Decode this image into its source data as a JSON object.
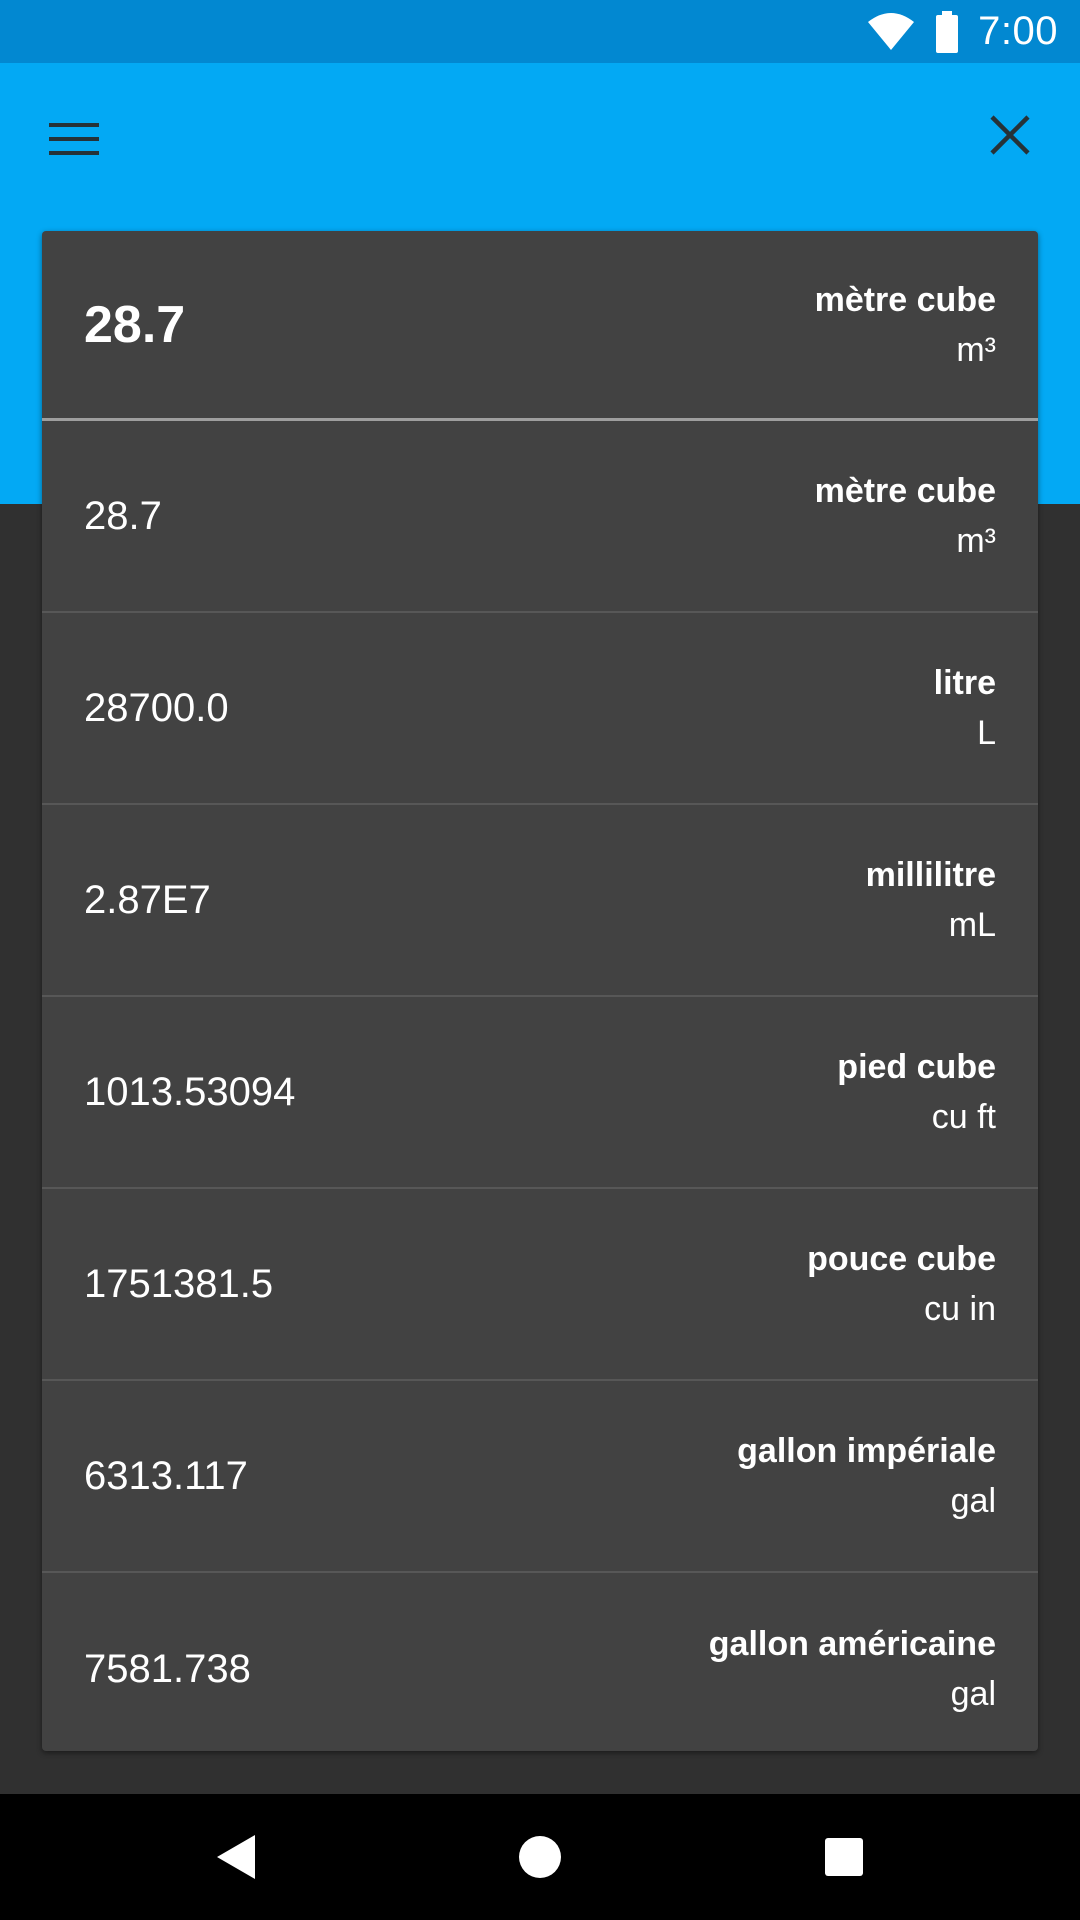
{
  "status_bar": {
    "time": "7:00",
    "icons": [
      "wifi-icon",
      "battery-icon"
    ]
  },
  "app_bar": {
    "menu_icon": "hamburger-menu-icon",
    "close_icon": "close-icon",
    "color": "#03A9F4"
  },
  "converter": {
    "input": {
      "value": "28.7",
      "unit_name": "mètre cube",
      "unit_symbol": "m³"
    },
    "results": [
      {
        "value": "28.7",
        "unit_name": "mètre cube",
        "unit_symbol": "m³"
      },
      {
        "value": "28700.0",
        "unit_name": "litre",
        "unit_symbol": "L"
      },
      {
        "value": "2.87E7",
        "unit_name": "millilitre",
        "unit_symbol": "mL"
      },
      {
        "value": "1013.53094",
        "unit_name": "pied cube",
        "unit_symbol": "cu ft"
      },
      {
        "value": "1751381.5",
        "unit_name": "pouce cube",
        "unit_symbol": "cu in"
      },
      {
        "value": "6313.117",
        "unit_name": "gallon impériale",
        "unit_symbol": "gal"
      },
      {
        "value": "7581.738",
        "unit_name": "gallon américaine",
        "unit_symbol": "gal"
      }
    ]
  },
  "nav_bar": {
    "icons": [
      "back-icon",
      "home-icon",
      "recents-icon"
    ]
  }
}
